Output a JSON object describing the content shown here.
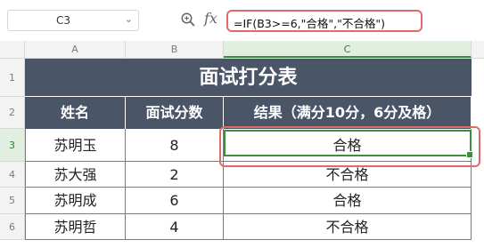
{
  "formula_bar": {
    "cell_ref": "C3",
    "formula": "=IF(B3>=6,\"合格\",\"不合格\")",
    "fx_label": "fx"
  },
  "columns": [
    "A",
    "B",
    "C"
  ],
  "rows": [
    "1",
    "2",
    "3",
    "4",
    "5",
    "6"
  ],
  "table": {
    "title": "面试打分表",
    "headers": [
      "姓名",
      "面试分数",
      "结果（满分10分，6分及格）"
    ],
    "records": [
      {
        "name": "苏明玉",
        "score": "8",
        "result": "合格"
      },
      {
        "name": "苏大强",
        "score": "2",
        "result": "不合格"
      },
      {
        "name": "苏明成",
        "score": "6",
        "result": "合格"
      },
      {
        "name": "苏明哲",
        "score": "4",
        "result": "不合格"
      }
    ]
  },
  "colors": {
    "header_fill": "#4a5568",
    "selection": "#3c8f3c",
    "highlight": "#e06a6a"
  }
}
